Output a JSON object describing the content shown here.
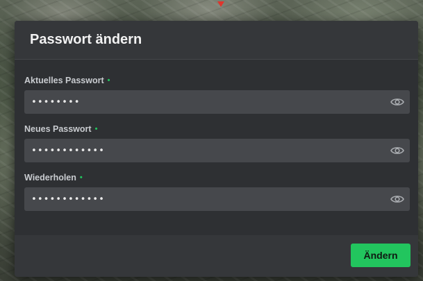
{
  "dialog": {
    "title": "Passwort ändern",
    "fields": [
      {
        "label": "Aktuelles Passwort",
        "value": "••••••••"
      },
      {
        "label": "Neues Passwort",
        "value": "••••••••••••"
      },
      {
        "label": "Wiederholen",
        "value": "••••••••••••"
      }
    ],
    "required_marker": "•",
    "submit_label": "Ändern"
  },
  "icons": {
    "visibility_toggle": "eye-icon"
  },
  "colors": {
    "accent": "#22c55e",
    "dialog_bg": "#2e3033",
    "input_bg": "#46484c"
  }
}
